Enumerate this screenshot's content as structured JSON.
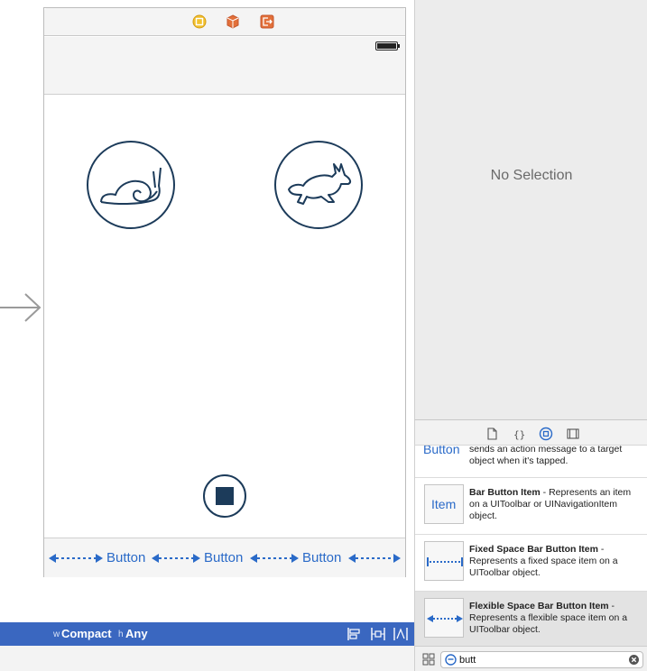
{
  "canvas": {
    "toolbar": {
      "buttons": [
        "Button",
        "Button",
        "Button"
      ]
    }
  },
  "size_class_bar": {
    "width_prefix": "w",
    "width_value": "Compact",
    "height_prefix": "h",
    "height_value": "Any"
  },
  "inspector": {
    "empty_label": "No Selection"
  },
  "library": {
    "items": [
      {
        "thumb": "Button",
        "title": "",
        "desc": "sends an action message to a target object when it's tapped."
      },
      {
        "thumb": "Item",
        "title": "Bar Button Item",
        "desc": " - Represents an item on a UIToolbar or UINavigationItem object."
      },
      {
        "thumb": "",
        "title": "Fixed Space Bar Button Item",
        "desc": " - Represents a fixed space item on a UIToolbar object."
      },
      {
        "thumb": "",
        "title": "Flexible Space Bar Button Item",
        "desc": " - Represents a flexible space item on a UIToolbar object."
      }
    ],
    "search": {
      "value": "butt"
    }
  },
  "colors": {
    "accent": "#3a67c0",
    "button_blue": "#2a6ac8",
    "icon_navy": "#1c3b5a"
  }
}
